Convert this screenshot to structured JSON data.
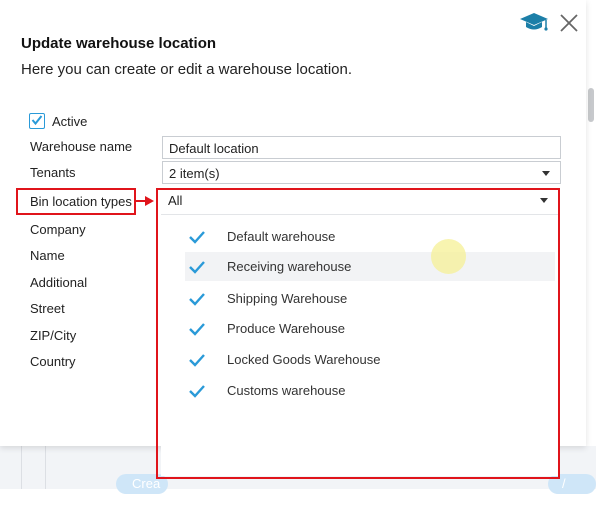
{
  "dialog": {
    "title": "Update warehouse location",
    "subtitle": "Here you can create or edit a warehouse location."
  },
  "icons": {
    "help": "graduation-cap-icon",
    "close": "close-icon",
    "checkmark": "checkmark-icon"
  },
  "colors": {
    "accent": "#2a9ad8",
    "highlight": "#e0141b",
    "help_icon": "#1c7fa8"
  },
  "form": {
    "active": {
      "label": "Active",
      "checked": true
    },
    "warehouse_name": {
      "label": "Warehouse name",
      "value": "Default location"
    },
    "tenants": {
      "label": "Tenants",
      "value": "2 item(s)"
    },
    "bin_location_types": {
      "label": "Bin location types",
      "value": "All"
    },
    "company_label": "Company",
    "name_label": "Name",
    "additional_label": "Additional",
    "street_label": "Street",
    "zip_city_label": "ZIP/City",
    "country_label": "Country"
  },
  "dropdown": {
    "items": [
      {
        "label": "Default warehouse",
        "checked": true
      },
      {
        "label": "Receiving warehouse",
        "checked": true
      },
      {
        "label": "Shipping Warehouse",
        "checked": true
      },
      {
        "label": "Produce Warehouse",
        "checked": true
      },
      {
        "label": "Locked Goods Warehouse",
        "checked": true
      },
      {
        "label": "Customs warehouse",
        "checked": true
      }
    ]
  },
  "background": {
    "left_button": "Crea",
    "right_button": "/ ware"
  }
}
